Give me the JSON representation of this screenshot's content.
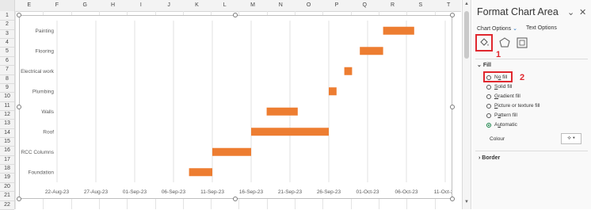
{
  "spreadsheet": {
    "columns": [
      "E",
      "F",
      "G",
      "H",
      "I",
      "J",
      "K",
      "L",
      "M",
      "N",
      "O",
      "P",
      "Q",
      "R",
      "S",
      "T"
    ],
    "rows": [
      "1",
      "2",
      "3",
      "4",
      "5",
      "6",
      "7",
      "8",
      "9",
      "10",
      "11",
      "12",
      "13",
      "14",
      "15",
      "16",
      "17",
      "18",
      "19",
      "20",
      "21",
      "22"
    ]
  },
  "chart_data": {
    "type": "bar",
    "orientation": "horizontal-gantt",
    "categories": [
      "Painting",
      "Flooring",
      "Electrical work",
      "Plumbing",
      "Walls",
      "Roof",
      "RCC Columns",
      "Foundation"
    ],
    "series": [
      {
        "values": [
          {
            "start": "2023-10-03",
            "end": "2023-10-07"
          },
          {
            "start": "2023-09-30",
            "end": "2023-10-03"
          },
          {
            "start": "2023-09-28",
            "end": "2023-09-29"
          },
          {
            "start": "2023-09-26",
            "end": "2023-09-27"
          },
          {
            "start": "2023-09-18",
            "end": "2023-09-22"
          },
          {
            "start": "2023-09-16",
            "end": "2023-09-26"
          },
          {
            "start": "2023-09-11",
            "end": "2023-09-16"
          },
          {
            "start": "2023-09-08",
            "end": "2023-09-11"
          }
        ]
      }
    ],
    "x_ticks": [
      "22-Aug-23",
      "27-Aug-23",
      "01-Sep-23",
      "06-Sep-23",
      "11-Sep-23",
      "16-Sep-23",
      "21-Sep-23",
      "26-Sep-23",
      "01-Oct-23",
      "06-Oct-23",
      "11-Oct-23"
    ],
    "xlim": [
      "2023-08-22",
      "2023-10-11"
    ],
    "grid": "vertical",
    "bar_color": "#ed7d31"
  },
  "panel": {
    "title": "Format Chart Area",
    "tab_chart_options": "Chart Options",
    "tab_text_options": "Text Options",
    "fill_section": "Fill",
    "options": [
      "No fill",
      "Solid fill",
      "Gradient fill",
      "Picture or texture fill",
      "Pattern fill",
      "Automatic"
    ],
    "selected_option": "Automatic",
    "colour_label": "Colour",
    "border_section": "Border",
    "step1": "1",
    "step2": "2",
    "highlight_color": "#e0272e"
  }
}
